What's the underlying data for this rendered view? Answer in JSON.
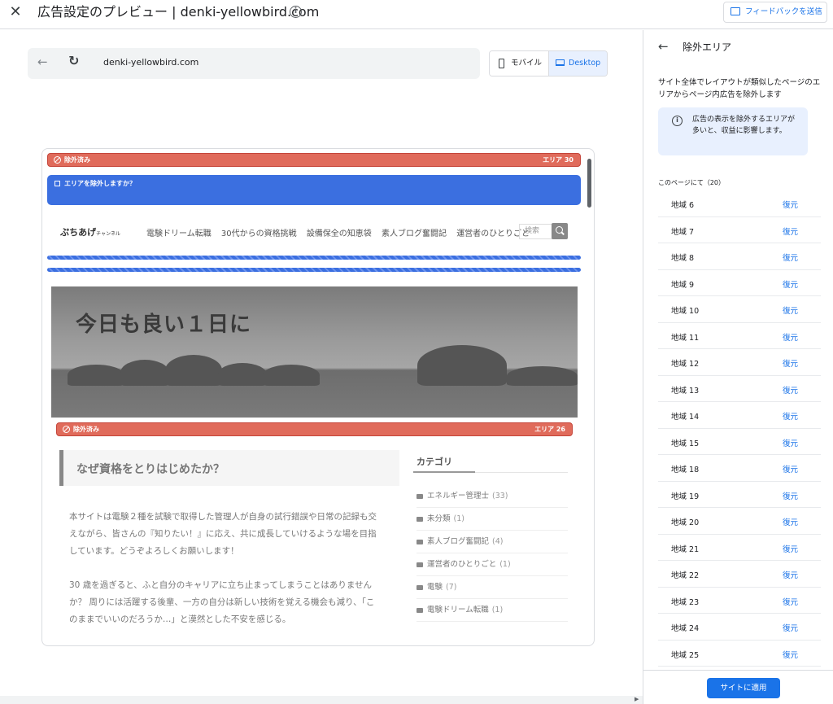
{
  "header": {
    "title": "広告設定のプレビュー | denki-yellowbird.com",
    "feedback_label": "フィードバックを送信"
  },
  "browser": {
    "url": "denki-yellowbird.com",
    "device_mobile": "モバイル",
    "device_desktop": "Desktop",
    "selected_device": "Desktop"
  },
  "preview": {
    "top_excluded": {
      "label": "除外済み",
      "area": "エリア 30"
    },
    "ask_label": "エリアを除外しますか？",
    "site": {
      "logo": "ぷちあげ",
      "logo_small": "チャンネル",
      "nav": [
        "電験ドリーム転職",
        "30代からの資格挑戦",
        "設備保全の知恵袋",
        "素人ブログ奮闘記",
        "運営者のひとりごと"
      ],
      "search_placeholder": "検索",
      "hero_title": "今日も良い１日に",
      "hero_excluded": {
        "label": "除外済み",
        "area": "エリア 26"
      },
      "article_heading": "なぜ資格をとりはじめたか？",
      "paragraph1_lines": [
        "本サイトは電験２種を試験で取得した管理人が自身の試行錯誤や日常の記録も交",
        "えながら、皆さんの『知りたい！』に応え、共に成長していけるような場を目指",
        "しています。どうぞよろしくお願いします！"
      ],
      "paragraph2_lines": [
        "30 歳を過ぎると、ふと自分のキャリアに立ち止まってしまうことはありません",
        "か？ 周りには活躍する後輩、一方の自分は新しい技術を覚える機会も減り、「こ",
        "のままでいいのだろうか…」と漠然とした不安を感じる。"
      ],
      "category_title": "カテゴリ",
      "categories": [
        {
          "name": "エネルギー管理士",
          "count": "(33)"
        },
        {
          "name": "未分類",
          "count": "(1)"
        },
        {
          "name": "素人ブログ奮闘記",
          "count": "(4)"
        },
        {
          "name": "運営者のひとりごと",
          "count": "(1)"
        },
        {
          "name": "電験",
          "count": "(7)"
        },
        {
          "name": "電験ドリーム転職",
          "count": "(1)"
        }
      ]
    }
  },
  "panel": {
    "title": "除外エリア",
    "description": "サイト全体でレイアウトが類似したページのエリアからページ内広告を除外します",
    "info": "広告の表示を除外するエリアが多いと、収益に影響します。",
    "count_label": "このページにて（20）",
    "restore_label": "復元",
    "areas": [
      "地域 6",
      "地域 7",
      "地域 8",
      "地域 9",
      "地域 10",
      "地域 11",
      "地域 12",
      "地域 13",
      "地域 14",
      "地域 15",
      "地域 18",
      "地域 19",
      "地域 20",
      "地域 21",
      "地域 22",
      "地域 23",
      "地域 24",
      "地域 25"
    ],
    "apply_label": "サイトに適用"
  },
  "colors": {
    "accent": "#1a73e8",
    "excluded": "#e06b5b",
    "ask": "#3b6fe0"
  },
  "icons": [
    "close-icon",
    "info-icon",
    "feedback-icon",
    "back-arrow-icon",
    "reload-icon",
    "phone-icon",
    "laptop-icon",
    "ban-icon",
    "search-icon",
    "folder-icon"
  ]
}
